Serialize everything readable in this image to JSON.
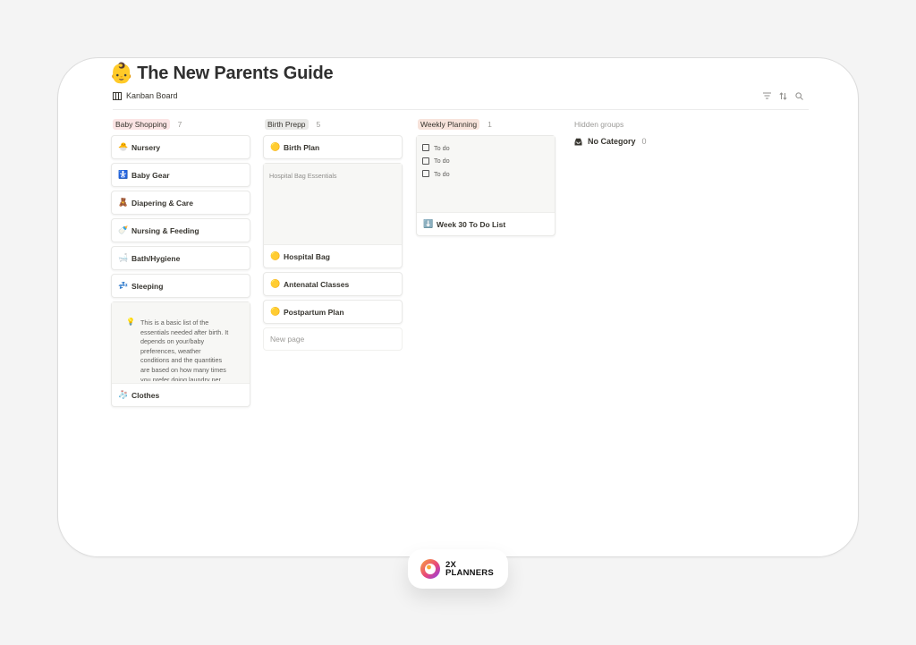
{
  "page": {
    "title_emoji": "👶",
    "title": "The New Parents Guide",
    "view_tab": "Kanban Board"
  },
  "columns": [
    {
      "name": "Baby Shopping",
      "count": "7",
      "tag_color": "#fbe4e4",
      "cards": [
        {
          "icon": "🐣",
          "label": "Nursery"
        },
        {
          "icon": "🚼",
          "label": "Baby Gear"
        },
        {
          "icon": "🧸",
          "label": "Diapering & Care"
        },
        {
          "icon": "🍼",
          "label": "Nursing & Feeding"
        },
        {
          "icon": "🛁",
          "label": "Bath/Hygiene"
        },
        {
          "icon": "💤",
          "label": "Sleeping"
        }
      ],
      "callout": {
        "icon": "💡",
        "text": "This is a basic list of the essentials needed after birth. It depends on your/baby preferences, weather conditions and the quantities are based on how many times you prefer doing laundry per"
      },
      "callout_card": {
        "icon": "🧦",
        "label": "Clothes"
      }
    },
    {
      "name": "Birth Prepp",
      "count": "5",
      "tag_color": "#e9e9e7",
      "first_card": {
        "icon": "🟡",
        "label": "Birth Plan"
      },
      "cover_caption": "Hospital Bag Essentials",
      "cover_card": {
        "icon": "🟡",
        "label": "Hospital Bag"
      },
      "cards": [
        {
          "icon": "🟡",
          "label": "Antenatal Classes"
        },
        {
          "icon": "🟡",
          "label": "Postpartum Plan"
        }
      ],
      "new_page": "New page"
    },
    {
      "name": "Weekly Planning",
      "count": "1",
      "tag_color": "#f7e3db",
      "todos": [
        "To do",
        "To do",
        "To do"
      ],
      "card": {
        "icon": "⬇️",
        "label": "Week 30 To Do List"
      }
    }
  ],
  "hidden_groups": {
    "heading": "Hidden groups",
    "items": [
      {
        "label": "No Category",
        "count": "0"
      }
    ]
  },
  "brand": {
    "line1": "2X",
    "line2": "PLANNERS"
  }
}
